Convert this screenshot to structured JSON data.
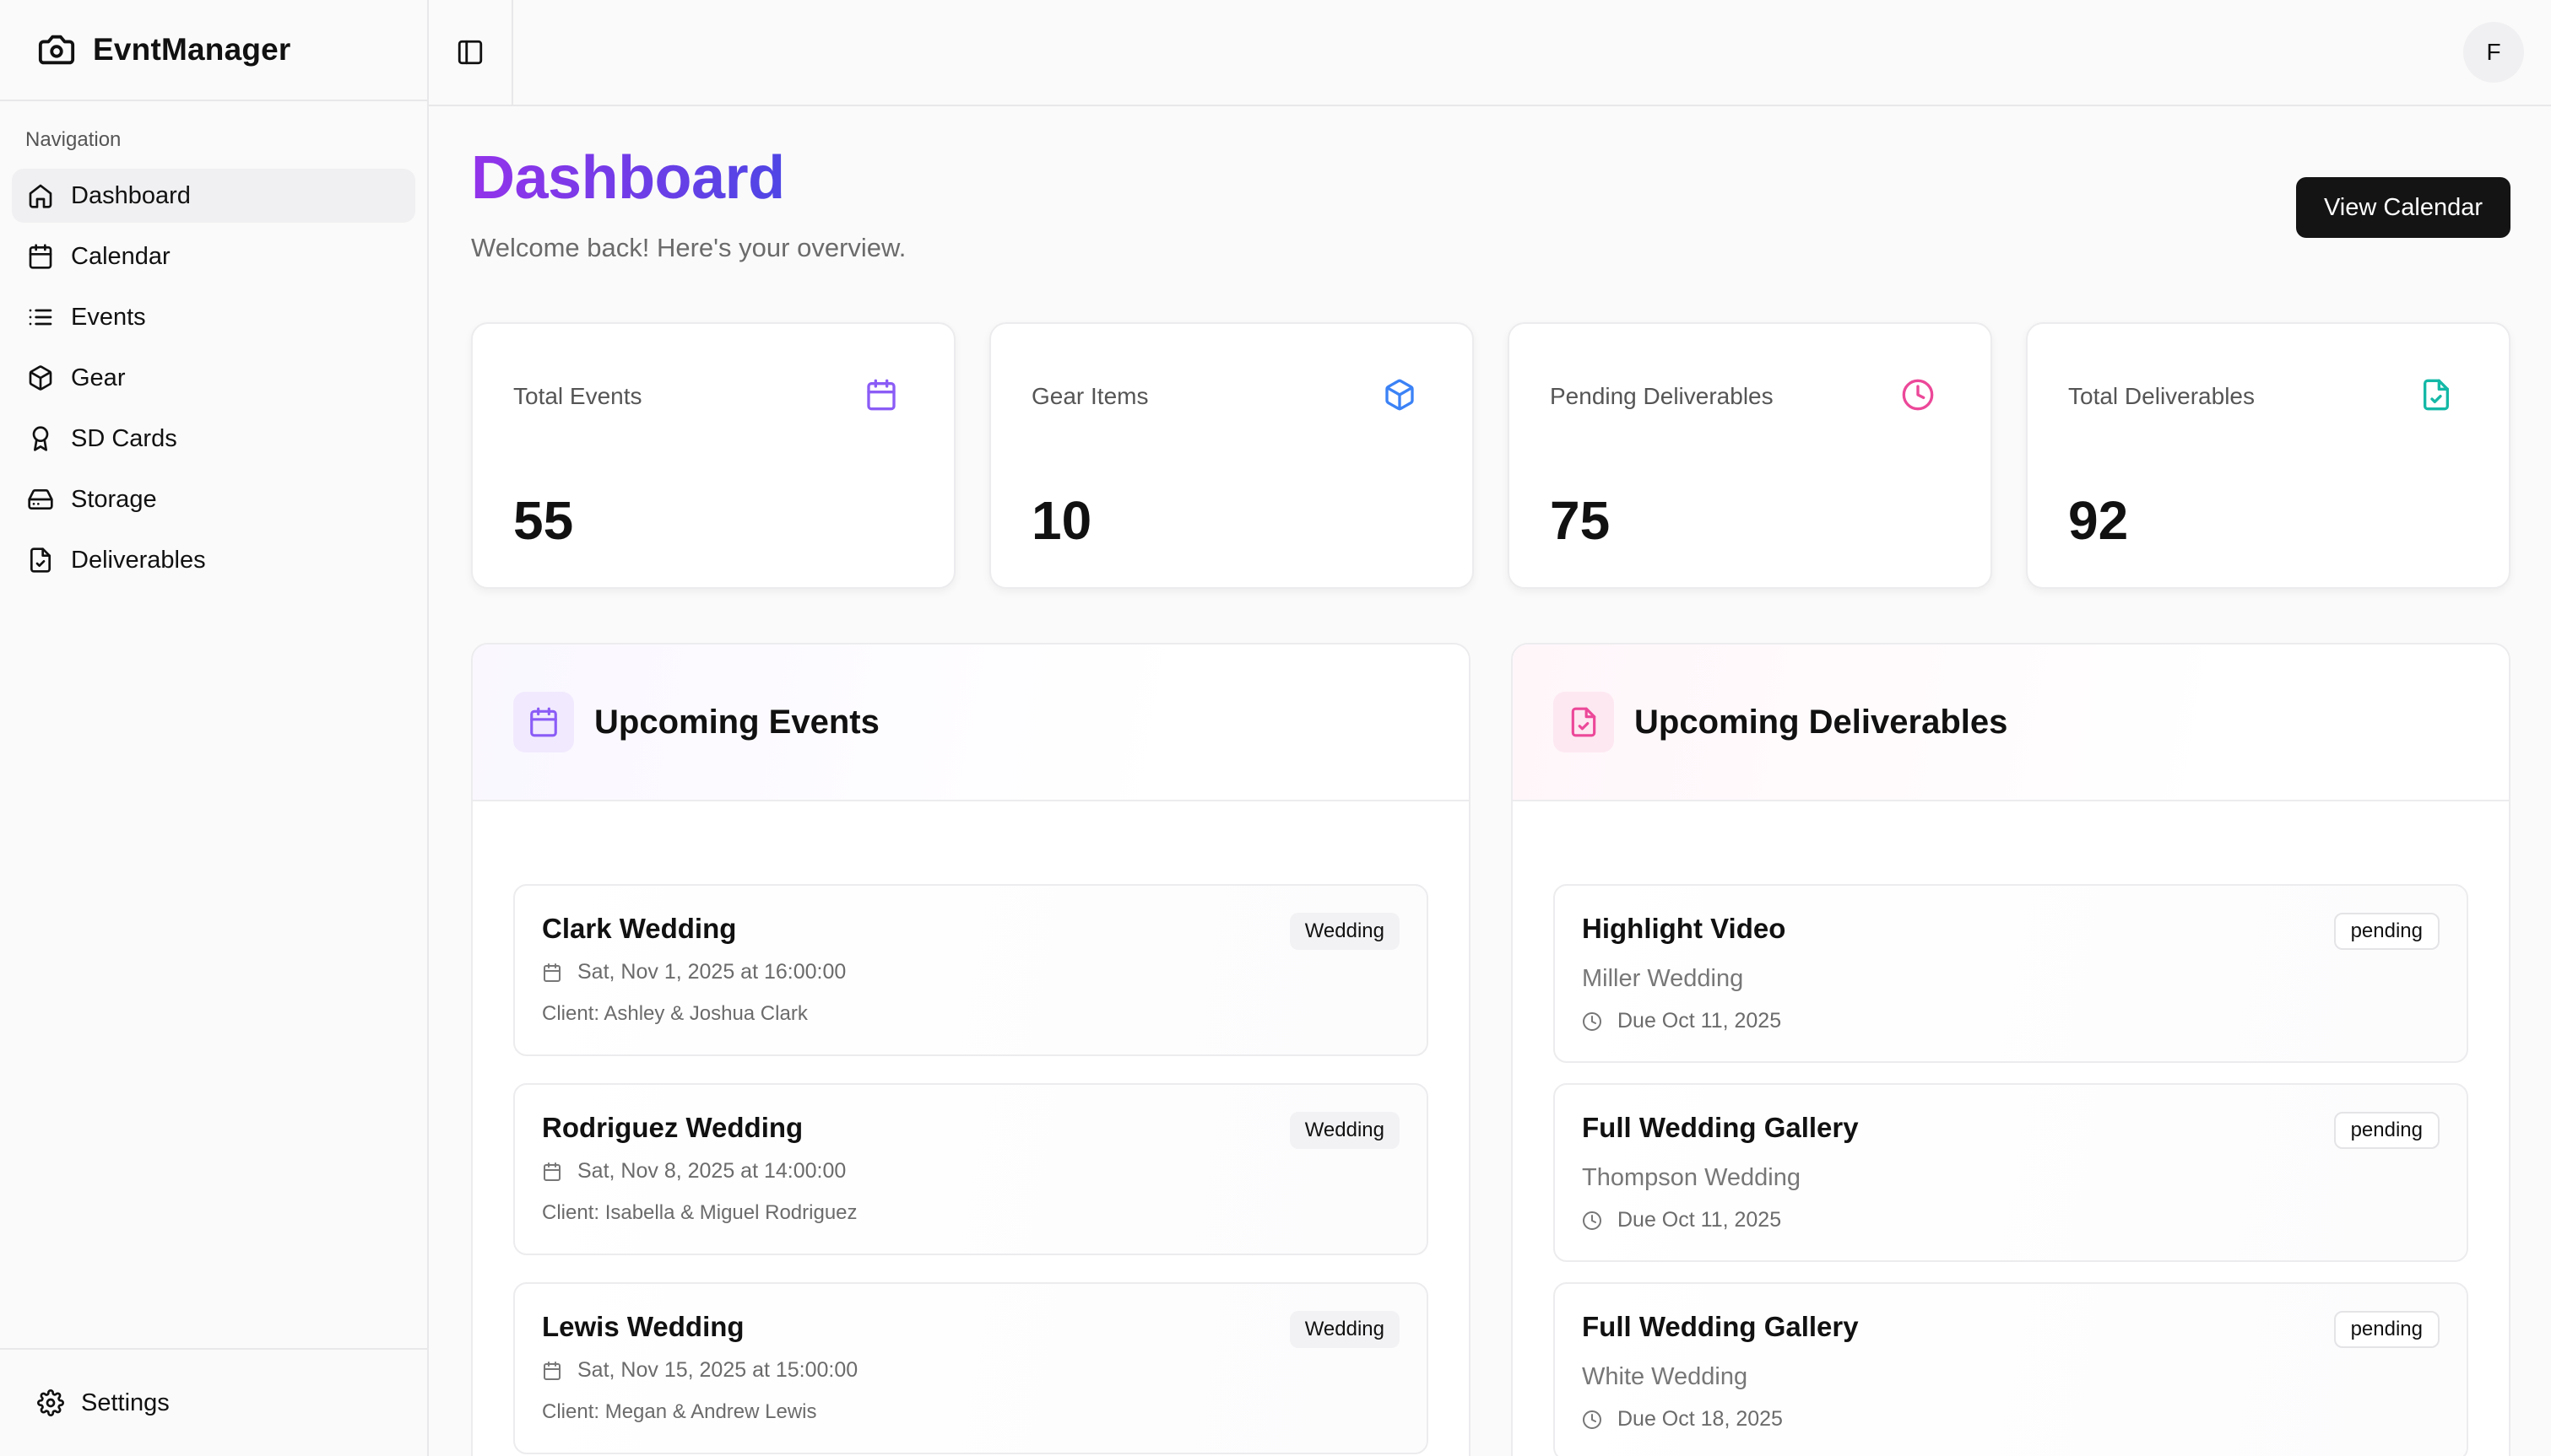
{
  "app": {
    "name": "EvntManager"
  },
  "sidebar": {
    "heading": "Navigation",
    "items": [
      {
        "label": "Dashboard",
        "icon": "home-icon",
        "active": true
      },
      {
        "label": "Calendar",
        "icon": "calendar-icon"
      },
      {
        "label": "Events",
        "icon": "list-icon"
      },
      {
        "label": "Gear",
        "icon": "box-icon"
      },
      {
        "label": "SD Cards",
        "icon": "award-icon"
      },
      {
        "label": "Storage",
        "icon": "hard-drive-icon"
      },
      {
        "label": "Deliverables",
        "icon": "file-check-icon"
      }
    ],
    "footer": {
      "label": "Settings",
      "icon": "gear-icon"
    }
  },
  "topbar": {
    "avatar_initial": "F"
  },
  "header": {
    "title": "Dashboard",
    "subtitle": "Welcome back! Here's your overview.",
    "view_calendar": "View Calendar"
  },
  "stats": [
    {
      "label": "Total Events",
      "value": "55",
      "icon": "calendar-icon",
      "color": "#8b5cf6"
    },
    {
      "label": "Gear Items",
      "value": "10",
      "icon": "box-icon",
      "color": "#3b82f6"
    },
    {
      "label": "Pending Deliverables",
      "value": "75",
      "icon": "clock-icon",
      "color": "#ec4899"
    },
    {
      "label": "Total Deliverables",
      "value": "92",
      "icon": "file-check-icon",
      "color": "#14b8a6"
    }
  ],
  "upcoming_events": {
    "title": "Upcoming Events",
    "items": [
      {
        "title": "Clark Wedding",
        "badge": "Wedding",
        "date": "Sat, Nov 1, 2025 at 16:00:00",
        "client": "Client: Ashley & Joshua Clark"
      },
      {
        "title": "Rodriguez Wedding",
        "badge": "Wedding",
        "date": "Sat, Nov 8, 2025 at 14:00:00",
        "client": "Client: Isabella & Miguel Rodriguez"
      },
      {
        "title": "Lewis Wedding",
        "badge": "Wedding",
        "date": "Sat, Nov 15, 2025 at 15:00:00",
        "client": "Client: Megan & Andrew Lewis"
      }
    ]
  },
  "upcoming_deliverables": {
    "title": "Upcoming Deliverables",
    "items": [
      {
        "title": "Highlight Video",
        "badge": "pending",
        "event": "Miller Wedding",
        "due": "Due Oct 11, 2025"
      },
      {
        "title": "Full Wedding Gallery",
        "badge": "pending",
        "event": "Thompson Wedding",
        "due": "Due Oct 11, 2025"
      },
      {
        "title": "Full Wedding Gallery",
        "badge": "pending",
        "event": "White Wedding",
        "due": "Due Oct 18, 2025"
      }
    ]
  },
  "colors": {
    "title_gradient": [
      "#9333ea",
      "#4f46e5"
    ],
    "button_bg": "#141414"
  }
}
